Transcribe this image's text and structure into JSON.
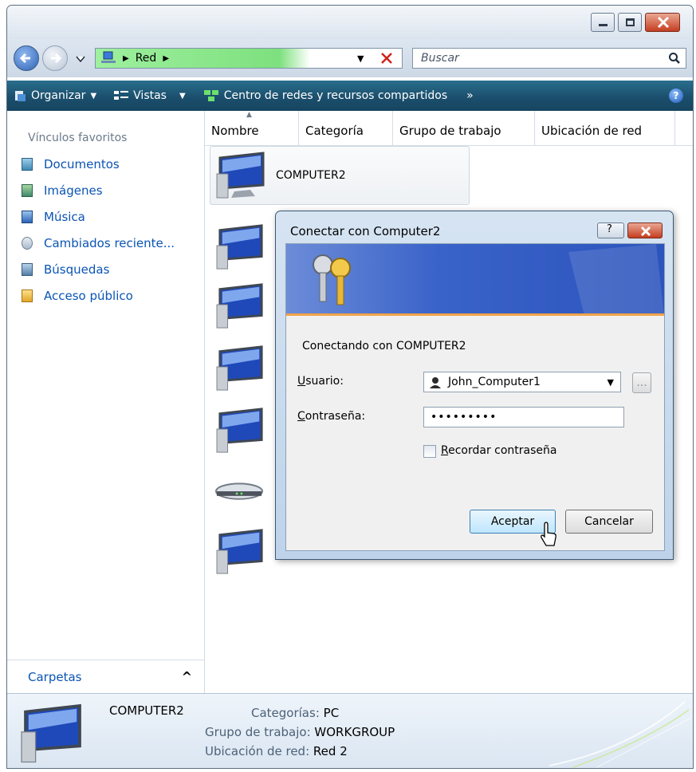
{
  "address": {
    "crumb": "Red",
    "search_placeholder": "Buscar"
  },
  "toolbar": {
    "organize": "Organizar",
    "views": "Vistas",
    "network_center": "Centro de redes y recursos compartidos",
    "more": "»"
  },
  "sidebar": {
    "header": "Vínculos favoritos",
    "items": [
      {
        "label": "Documentos",
        "icon": "documents-icon"
      },
      {
        "label": "Imágenes",
        "icon": "pictures-icon"
      },
      {
        "label": "Música",
        "icon": "music-icon"
      },
      {
        "label": "Cambiados reciente...",
        "icon": "recent-icon"
      },
      {
        "label": "Búsquedas",
        "icon": "searches-icon"
      },
      {
        "label": "Acceso público",
        "icon": "public-folder-icon"
      }
    ],
    "folders_label": "Carpetas",
    "folders_toggle": "^"
  },
  "columns": [
    "Nombre",
    "Categoría",
    "Grupo de trabajo",
    "Ubicación de red"
  ],
  "selected_item": {
    "name": "COMPUTER2"
  },
  "details": {
    "name": "COMPUTER2",
    "category_label": "Categorías:",
    "category_value": "PC",
    "workgroup_label": "Grupo de trabajo:",
    "workgroup_value": "WORKGROUP",
    "location_label": "Ubicación de red:",
    "location_value": "Red 2"
  },
  "dialog": {
    "title": "Conectar con Computer2",
    "message": "Conectando con COMPUTER2",
    "user_label_u": "U",
    "user_label_rest": "suario:",
    "user_value": "John_Computer1",
    "password_label_c": "C",
    "password_label_rest": "ontraseña:",
    "password_value": "•••••••••",
    "remember_r": "R",
    "remember_rest": "ecordar contraseña",
    "remember_checked": false,
    "ok": "Aceptar",
    "cancel": "Cancelar",
    "browse": "..."
  },
  "colors": {
    "accent": "#1b4f6d",
    "link": "#0a54b4",
    "dialog_banner": "#2c54bd"
  }
}
